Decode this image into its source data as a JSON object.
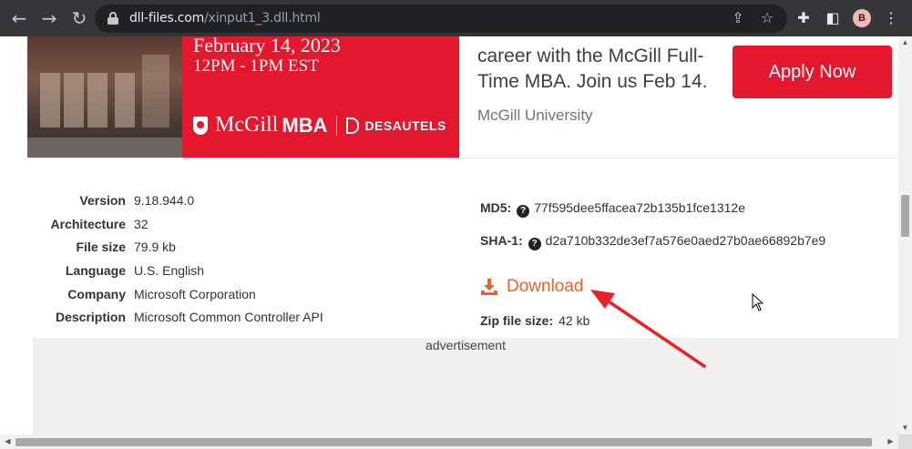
{
  "browser": {
    "url_host": "dll-files.com",
    "url_path": "/xinput1_3.dll.html",
    "profile_initial": "B"
  },
  "ad": {
    "date": "February 14, 2023",
    "time": "12PM - 1PM EST",
    "brand_name": "McGill",
    "brand_program": "MBA",
    "brand_partner": "DESAUTELS",
    "text": "career with the McGill Full-Time MBA. Join us Feb 14.",
    "source": "McGill University",
    "cta_label": "Apply Now",
    "accent_color": "#e3182e"
  },
  "file_info": {
    "rows": [
      {
        "label": "Version",
        "value": "9.18.944.0"
      },
      {
        "label": "Architecture",
        "value": "32"
      },
      {
        "label": "File size",
        "value": "79.9 kb"
      },
      {
        "label": "Language",
        "value": "U.S. English"
      },
      {
        "label": "Company",
        "value": "Microsoft Corporation"
      },
      {
        "label": "Description",
        "value": "Microsoft Common Controller API"
      }
    ]
  },
  "hashes": {
    "md5_label": "MD5:",
    "md5_value": "77f595dee5ffacea72b135b1fce1312e",
    "sha1_label": "SHA-1:",
    "sha1_value": "d2a710b332de3ef7a576e0aed27b0ae66892b7e9"
  },
  "download": {
    "label": "Download",
    "color": "#e8632b",
    "zip_label": "Zip file size:",
    "zip_value": "42 kb"
  },
  "advertisement_label": "advertisement",
  "icons": {
    "back": "back-arrow-icon",
    "forward": "forward-arrow-icon",
    "reload": "reload-icon",
    "lock": "lock-icon",
    "share": "share-icon",
    "bookmark": "star-icon",
    "extensions": "puzzle-icon",
    "side_panel": "side-panel-icon",
    "menu": "kebab-menu-icon",
    "help": "question-circle-icon",
    "download": "download-tray-icon"
  }
}
